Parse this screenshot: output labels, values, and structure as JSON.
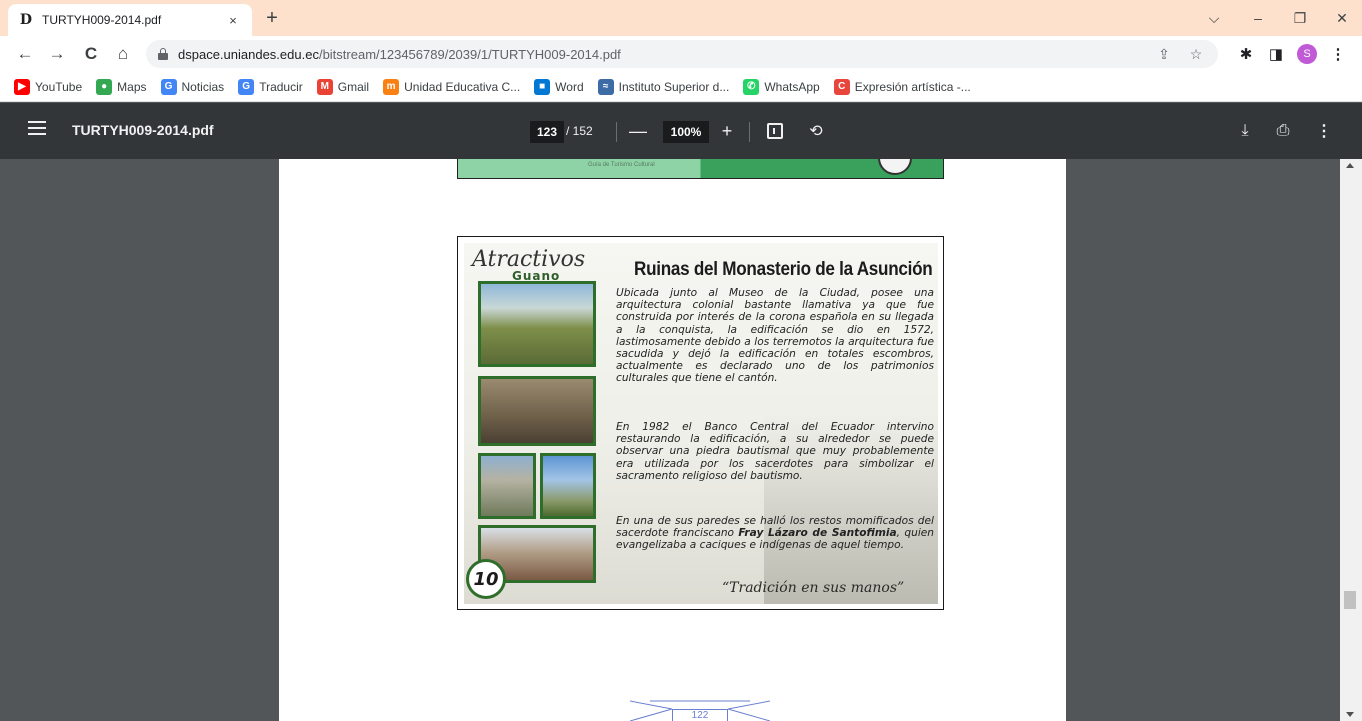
{
  "tab": {
    "title": "TURTYH009-2014.pdf",
    "favicon": "D",
    "close": "×",
    "new_tab": "+"
  },
  "window_controls": {
    "dropdown": "⌵",
    "minimize": "–",
    "restore": "❐",
    "close": "✕"
  },
  "nav": {
    "back": "←",
    "forward": "→",
    "reload": "C",
    "home": "⌂"
  },
  "address": {
    "host": "dspace.uniandes.edu.ec",
    "path": "/bitstream/123456789/2039/1/TURTYH009-2014.pdf"
  },
  "profile": {
    "initial": "S",
    "color": "#c15ad6"
  },
  "bookmarks": [
    {
      "label": "YouTube",
      "icon": "youtube-icon",
      "color": "#ff0000",
      "glyph": "▶"
    },
    {
      "label": "Maps",
      "icon": "maps-pin-icon",
      "color": "#34a853",
      "glyph": "●"
    },
    {
      "label": "Noticias",
      "icon": "news-icon",
      "color": "#4285f4",
      "glyph": "G"
    },
    {
      "label": "Traducir",
      "icon": "translate-icon",
      "color": "#4285f4",
      "glyph": "G"
    },
    {
      "label": "Gmail",
      "icon": "gmail-icon",
      "color": "#ea4335",
      "glyph": "M"
    },
    {
      "label": "Unidad Educativa C...",
      "icon": "moodle-icon",
      "color": "#f98012",
      "glyph": "m"
    },
    {
      "label": "Word",
      "icon": "windows-icon",
      "color": "#0078d4",
      "glyph": "■"
    },
    {
      "label": "Instituto Superior d...",
      "icon": "institute-icon",
      "color": "#3c6ba5",
      "glyph": "≈"
    },
    {
      "label": "WhatsApp",
      "icon": "whatsapp-icon",
      "color": "#25d366",
      "glyph": "✆"
    },
    {
      "label": "Expresión artística -...",
      "icon": "canva-c-icon",
      "color": "#e8453c",
      "glyph": "C"
    }
  ],
  "pdf": {
    "title": "TURTYH009-2014.pdf",
    "page_current": "123",
    "page_total": "/ 152",
    "zoom": "100%",
    "zoom_out": "—",
    "zoom_in": "+",
    "rotate": "⟲",
    "download": "⤓",
    "print": "⎙",
    "more": "⋮"
  },
  "prev_image": {
    "caption": "Guía de Turismo Cultural"
  },
  "poster": {
    "brand": "Atractivos",
    "brand_sub": "Guano",
    "title": "Ruinas del Monasterio de la Asunción",
    "p1": "Ubicada junto al Museo de la Ciudad, posee una arquitectura colonial bastante llamativa ya que fue construida por interés de la corona española en su llegada a la conquista, la edificación se dio en 1572, lastimosamente debido a los terremotos la arquitectura fue sacudida y dejó la edificación en totales escombros, actualmente es declarado uno de los patrimonios culturales que tiene el cantón.",
    "p2": "En 1982 el Banco Central del Ecuador intervino restaurando la edificación, a su alrededor se puede observar una piedra bautismal que muy probablemente era utilizada por los sacerdotes para simbolizar el sacramento religioso del bautismo.",
    "p3_before": "En una de sus paredes se halló los restos momificados del sacerdote franciscano ",
    "p3_bold": "Fray Lázaro de Santofimia",
    "p3_after": ", quien evangelizaba a caciques e indígenas de aquel tiempo.",
    "number": "10",
    "tagline": "“Tradición en sus manos”"
  },
  "page_footer": {
    "number": "122"
  }
}
